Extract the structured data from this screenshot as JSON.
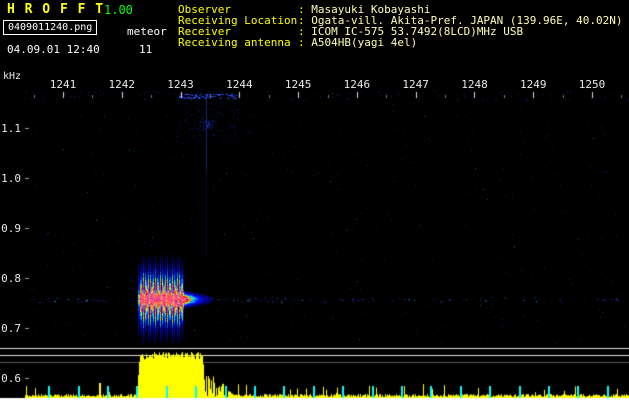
{
  "app": {
    "title": "H R O F F T",
    "version": "1.00",
    "filename": "0409011240.png",
    "mode": "meteor",
    "count": "11",
    "datetime": "04.09.01 12:40"
  },
  "header_info": {
    "separator": ":",
    "rows": [
      {
        "label": "Observer",
        "value": "Masayuki Kobayashi"
      },
      {
        "label": "Receiving Location",
        "value": "Ogata-vill. Akita-Pref. JAPAN (139.96E, 40.02N)"
      },
      {
        "label": "Receiver",
        "value": "ICOM IC-575 53.7492(8LCD)MHz USB"
      },
      {
        "label": "Receiving antenna",
        "value": "A504HB(yagi 4el)"
      }
    ]
  },
  "colors": {
    "background": "#000000",
    "title": "#ffff00",
    "version": "#00ff00",
    "header_label": "#ffff00",
    "header_value": "#ffffb0",
    "axis_text": "#e8e8e8",
    "noise_dot": "#2830d2",
    "level_graph": "#ffff00",
    "half_minute_marker": "#00ffff"
  },
  "chart_data": {
    "type": "heatmap",
    "subtype": "radio-meteor-spectrogram",
    "title": "",
    "xlabel": "",
    "ylabel": "kHz",
    "grid": false,
    "x_ticks": [
      "1241",
      "1242",
      "1243",
      "1244",
      "1245",
      "1246",
      "1247",
      "1248",
      "1249",
      "1250"
    ],
    "y_ticks": [
      "1.1",
      "1.0",
      "0.9",
      "0.8",
      "0.7",
      "0.6"
    ],
    "time_range_min": [
      1240.4,
      1250.6
    ],
    "freq_range_khz": [
      0.55,
      1.2
    ],
    "noise_line_khz": 0.757,
    "events": [
      {
        "name": "meteor-echo-overdense",
        "time_start": 1242.25,
        "time_end": 1243.55,
        "main_body_end": 1243.05,
        "freq_center_khz": 0.758,
        "visible_freq_low_khz": 0.67,
        "visible_freq_high_khz": 0.87,
        "core_color": "#ff3060",
        "mid_color": "#ffff00",
        "edge_color": "#0000ff"
      },
      {
        "name": "upper-band-noise-patch",
        "time_start": 1242.9,
        "time_end": 1244.0,
        "freq_low_khz": 1.07,
        "freq_high_khz": 1.17,
        "color": "#2238e0"
      }
    ],
    "signal_level": {
      "burst_time_start": 1242.25,
      "burst_time_end": 1243.42,
      "burst_decay_end": 1243.92,
      "burst_peak_frac": 0.9,
      "noise_frac": 0.05,
      "color": "#ffff00"
    },
    "time_markers": {
      "interval_min": 0.5,
      "first_min": 1240.75,
      "color": "#00ffff"
    }
  }
}
